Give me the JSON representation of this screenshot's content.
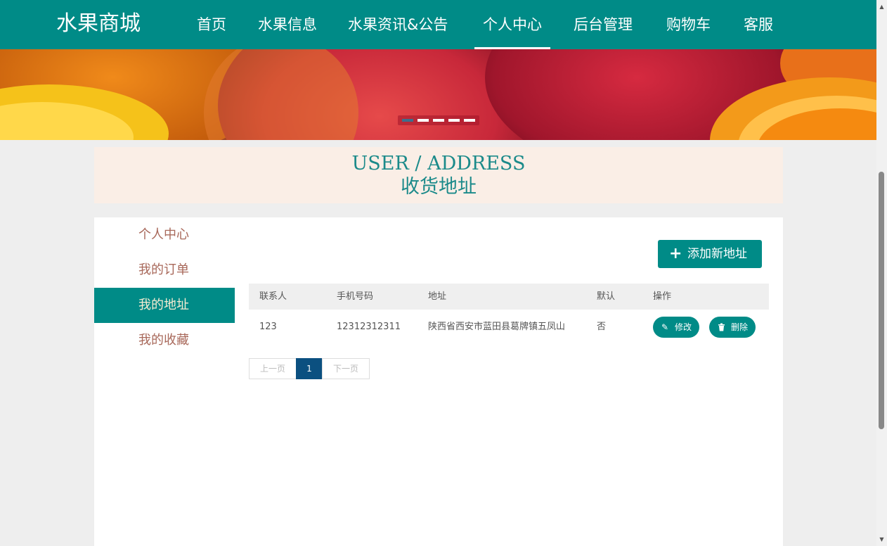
{
  "header": {
    "brand": "水果商城",
    "nav": [
      {
        "label": "首页"
      },
      {
        "label": "水果信息"
      },
      {
        "label": "水果资讯&公告"
      },
      {
        "label": "个人中心",
        "active": true
      },
      {
        "label": "后台管理"
      },
      {
        "label": "购物车"
      },
      {
        "label": "客服"
      }
    ]
  },
  "banner": {
    "slide_count": 5,
    "active_slide": 1
  },
  "page_title": {
    "en": "USER / ADDRESS",
    "cn": "收货地址"
  },
  "sidebar": {
    "items": [
      {
        "label": "个人中心"
      },
      {
        "label": "我的订单"
      },
      {
        "label": "我的地址",
        "active": true
      },
      {
        "label": "我的收藏"
      }
    ]
  },
  "actions": {
    "add_label": "添加新地址",
    "add_icon": "plus-icon"
  },
  "table": {
    "headers": [
      "联系人",
      "手机号码",
      "地址",
      "默认",
      "操作"
    ],
    "rows": [
      {
        "contact": "123",
        "phone": "12312312311",
        "address": "陕西省西安市蓝田县葛牌镇五凤山",
        "default": "否",
        "edit_label": "修改",
        "delete_label": "删除"
      }
    ]
  },
  "pagination": {
    "prev": "上一页",
    "current": "1",
    "next": "下一页"
  },
  "colors": {
    "primary": "#008b87",
    "title_bg": "#faeee6",
    "sidebar_text": "#a8685a",
    "pager_active": "#0b5080"
  }
}
